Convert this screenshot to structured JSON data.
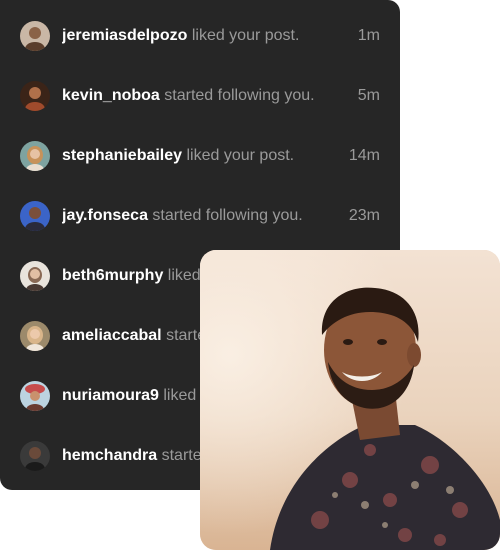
{
  "notifications": [
    {
      "username": "jeremiasdelpozo",
      "action": "liked your post.",
      "time": "1m",
      "avatar_colors": [
        "#c9b7a6",
        "#5a3d2b"
      ]
    },
    {
      "username": "kevin_noboa",
      "action": "started following you.",
      "time": "5m",
      "avatar_colors": [
        "#a04b2c",
        "#3b2418"
      ]
    },
    {
      "username": "stephaniebailey",
      "action": "liked your post.",
      "time": "14m",
      "avatar_colors": [
        "#7ea3a0",
        "#c7925a"
      ]
    },
    {
      "username": "jay.fonseca",
      "action": "started following you.",
      "time": "23m",
      "avatar_colors": [
        "#3b64c8",
        "#7a4f3a"
      ]
    },
    {
      "username": "beth6murphy",
      "action": "liked your post.",
      "time": "",
      "avatar_colors": [
        "#e9e4dc",
        "#8a6a55"
      ]
    },
    {
      "username": "ameliaccabal",
      "action": "started following you.",
      "time": "",
      "avatar_colors": [
        "#9c8a6b",
        "#d9b58a"
      ]
    },
    {
      "username": "nuriamoura9",
      "action": "liked your post.",
      "time": "",
      "avatar_colors": [
        "#c74c4c",
        "#6a3b30"
      ]
    },
    {
      "username": "hemchandra",
      "action": "started following you.",
      "time": "",
      "avatar_colors": [
        "#3a3a3a",
        "#1a1a1a"
      ]
    }
  ],
  "colors": {
    "panel_bg": "#262626",
    "username": "#ffffff",
    "action": "#9a9a9a",
    "photo_bg_top": "#f3e2d3",
    "photo_bg_bottom": "#d9b493"
  }
}
